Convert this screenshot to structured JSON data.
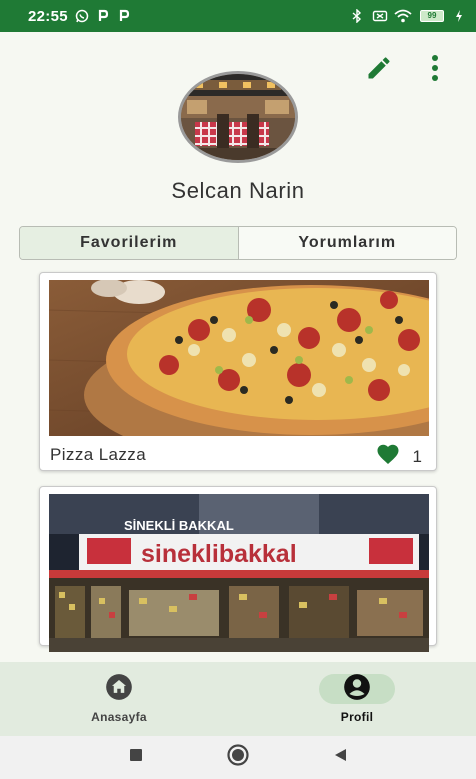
{
  "status_bar": {
    "time": "22:55",
    "left_icons": [
      "whatsapp-icon",
      "p-notification-icon",
      "p-notification-icon"
    ],
    "right_icons": [
      "bluetooth-icon",
      "mute-icon",
      "wifi-icon",
      "battery-icon",
      "charging-icon"
    ],
    "battery_level": "99"
  },
  "header": {
    "edit_icon": "pencil-icon",
    "menu_icon": "more-vert-icon"
  },
  "profile": {
    "name": "Selcan Narin"
  },
  "tabs": [
    {
      "label": "Favorilerim",
      "active": true
    },
    {
      "label": "Yorumlarım",
      "active": false
    }
  ],
  "favorites": [
    {
      "name": "Pizza Lazza",
      "likes": "1",
      "image": "pizza-photo"
    },
    {
      "name": "",
      "likes": "",
      "image": "sinekli-bakkal-storefront-photo"
    }
  ],
  "bottom_nav": [
    {
      "label": "Anasayfa",
      "icon": "home-icon",
      "active": false
    },
    {
      "label": "Profil",
      "icon": "account-circle-icon",
      "active": true
    }
  ],
  "colors": {
    "primary": "#1f7a35",
    "nav_background": "#e2ebdf",
    "active_indicator": "#c7dec5",
    "heart": "#1f7a35"
  },
  "storefront_sign": "SİNEKLİ BAKKAL",
  "storefront_banner": "sineklibakkal"
}
